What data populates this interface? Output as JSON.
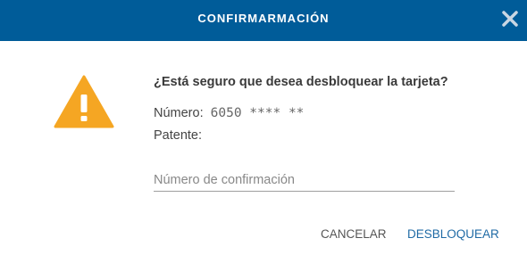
{
  "dialog": {
    "title": "CONFIRMARMACIÓN",
    "question": "¿Está seguro que desea desbloquear la tarjeta?",
    "number_label": "Número:",
    "number_value": "6050 **** **",
    "plate_label": "Patente:",
    "plate_value": "",
    "confirmation_placeholder": "Número de confirmación",
    "confirmation_value": "",
    "cancel_label": "CANCELAR",
    "unlock_label": "DESBLOQUEAR"
  },
  "icons": {
    "close": "close-icon",
    "warning": "warning-icon"
  },
  "colors": {
    "header": "#005c99",
    "warning": "#f5a623",
    "primary_action": "#1f6aa5",
    "secondary_action": "#555555"
  }
}
